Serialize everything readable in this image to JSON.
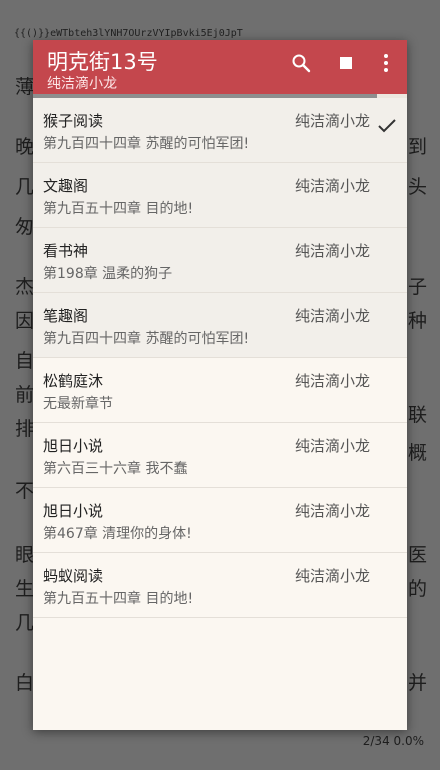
{
  "status_line": "{{()}}eWTbteh3lYNH7OUrzVYIpBvki5Ej0JpT",
  "background_text": {
    "left": [
      "薄",
      "晚",
      "几",
      "匆",
      "杰",
      "因",
      "自",
      "前",
      "排",
      "不",
      "眼",
      "生",
      "几",
      "白"
    ],
    "right": [
      "到",
      "头",
      "子",
      "种",
      "联",
      "概",
      "医",
      "的",
      "并"
    ]
  },
  "page_info": "2/34 0.0%",
  "toolbar": {
    "title": "明克街13号",
    "subtitle": "纯洁滴小龙",
    "search_icon": "search-icon",
    "stop_icon": "stop-icon",
    "more_icon": "more-vert-icon",
    "progress": 0.92,
    "color": "#c4474d"
  },
  "sources": [
    {
      "name": "猴子阅读",
      "author": "纯洁滴小龙",
      "latest": "第九百四十四章 苏醒的可怕军团!",
      "selected": true,
      "shaded": true
    },
    {
      "name": "文趣阁",
      "author": "纯洁滴小龙",
      "latest": "第九百五十四章 目的地!",
      "selected": false,
      "shaded": true
    },
    {
      "name": "看书神",
      "author": "纯洁滴小龙",
      "latest": "第198章 温柔的狗子",
      "selected": false,
      "shaded": true
    },
    {
      "name": "笔趣阁",
      "author": "纯洁滴小龙",
      "latest": "第九百四十四章 苏醒的可怕军团!",
      "selected": false,
      "shaded": true
    },
    {
      "name": " 松鹤庭沐",
      "author": "纯洁滴小龙",
      "latest": "无最新章节",
      "selected": false,
      "shaded": false
    },
    {
      "name": " 旭日小说",
      "author": "纯洁滴小龙",
      "latest": "第六百三十六章 我不蠢",
      "selected": false,
      "shaded": false
    },
    {
      "name": " 旭日小说",
      "author": "纯洁滴小龙",
      "latest": "第467章 清理你的身体!",
      "selected": false,
      "shaded": false
    },
    {
      "name": " 蚂蚁阅读",
      "author": "纯洁滴小龙",
      "latest": "第九百五十四章 目的地!",
      "selected": false,
      "shaded": false
    }
  ]
}
